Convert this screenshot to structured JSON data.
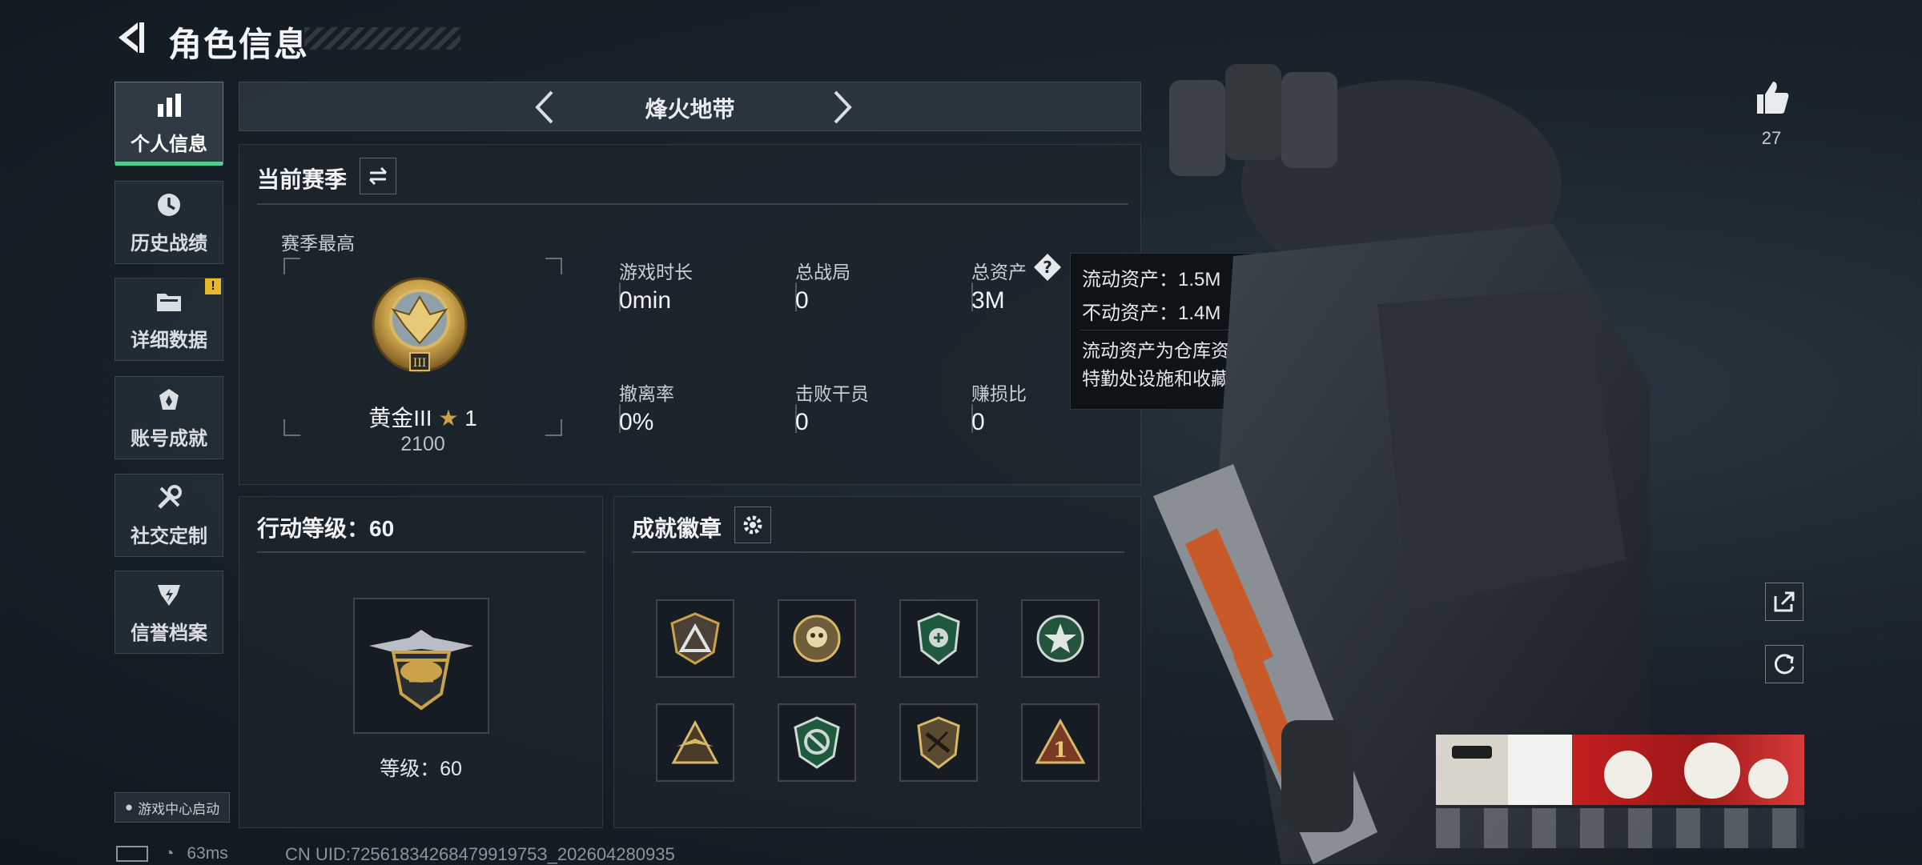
{
  "header": {
    "title": "角色信息"
  },
  "sidebar": {
    "items": [
      {
        "label": "个人信息",
        "icon": "bar-chart-icon"
      },
      {
        "label": "历史战绩",
        "icon": "clock-history-icon"
      },
      {
        "label": "详细数据",
        "icon": "folder-icon",
        "badge": "!"
      },
      {
        "label": "账号成就",
        "icon": "achievement-icon"
      },
      {
        "label": "社交定制",
        "icon": "tools-icon"
      },
      {
        "label": "信誉档案",
        "icon": "reputation-icon"
      }
    ]
  },
  "mode": {
    "title": "烽火地带"
  },
  "season": {
    "title": "当前赛季",
    "best_label": "赛季最高",
    "rank_name": "黄金III",
    "rank_stars": "1",
    "rank_score": "2100",
    "stats": [
      {
        "label": "游戏时长",
        "value": "0min"
      },
      {
        "label": "总战局",
        "value": "0"
      },
      {
        "label": "总资产",
        "value": "3M"
      },
      {
        "label": "撤离率",
        "value": "0%"
      },
      {
        "label": "击败干员",
        "value": "0"
      },
      {
        "label": "赚损比",
        "value": "0"
      }
    ]
  },
  "tooltip": {
    "line1": "流动资产：1.5M",
    "line2": "不动资产：1.4M",
    "desc": "流动资产为仓库资产和哈夫币，不动资产为特勤处设施和收藏室设施"
  },
  "level": {
    "title": "行动等级：60",
    "caption": "等级：60"
  },
  "badges": {
    "title": "成就徽章",
    "items": [
      "triangle-shield-badge",
      "skull-wreath-badge",
      "green-shield-badge",
      "star-wreath-badge",
      "wings-triangle-badge",
      "green-arrows-badge",
      "rifle-shield-badge",
      "number-one-badge"
    ]
  },
  "likes": {
    "count": "27"
  },
  "footer": {
    "game_center": "游戏中心启动",
    "ping": "63ms",
    "uid": "CN UID:7256183426847991975З_202604280935"
  },
  "colors": {
    "accent": "#4fd08a",
    "gold": "#c9a24a",
    "warning": "#e6b82e"
  }
}
